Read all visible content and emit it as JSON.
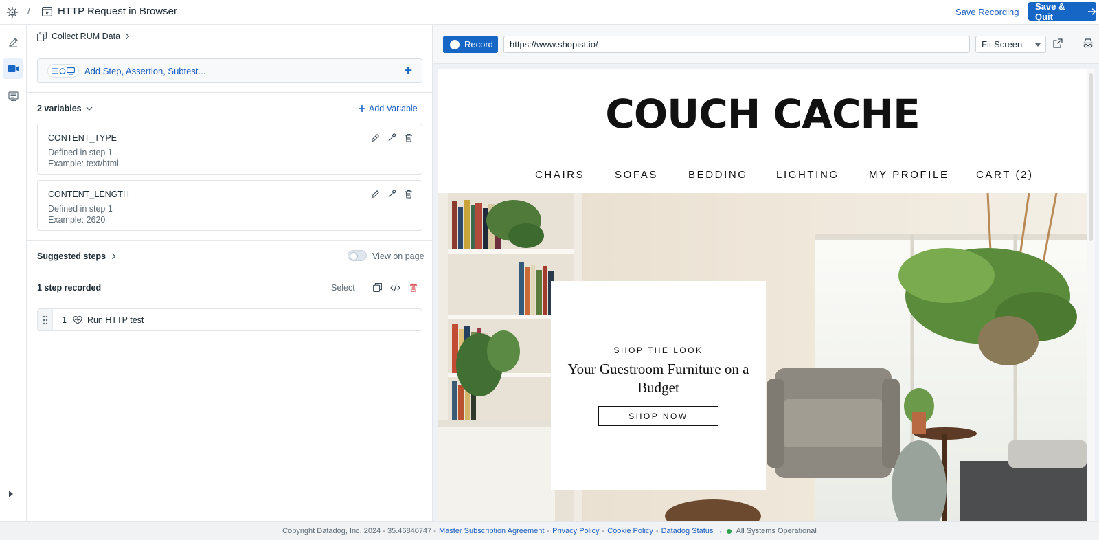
{
  "header": {
    "separator": "/",
    "title": "HTTP Request in Browser",
    "save_recording": "Save Recording",
    "save_quit": "Save & Quit",
    "accent_color": "#1666c5"
  },
  "rail": {
    "items": [
      {
        "icon": "pencil-icon"
      },
      {
        "icon": "video-camera-icon",
        "active": true
      },
      {
        "icon": "list-icon"
      }
    ]
  },
  "panel": {
    "breadcrumb": "Collect RUM Data",
    "add_step_label": "Add Step, Assertion, Subtest...",
    "add_step_plus": "+",
    "variables_heading": "2 variables",
    "add_variable": "Add Variable",
    "variables": [
      {
        "name": "CONTENT_TYPE",
        "defined": "Defined in step 1",
        "example": "Example: text/html"
      },
      {
        "name": "CONTENT_LENGTH",
        "defined": "Defined in step 1",
        "example": "Example: 2620"
      }
    ],
    "suggested_steps": "Suggested steps",
    "view_on_page": "View on page",
    "steps_recorded": "1 step recorded",
    "select_label": "Select",
    "steps": [
      {
        "number": "1",
        "label": "Run HTTP test"
      }
    ]
  },
  "browser": {
    "record_label": "Record",
    "url": "https://www.shopist.io/",
    "fit_select": "Fit Screen"
  },
  "site": {
    "logo": "COUCH CACHE",
    "nav": [
      "CHAIRS",
      "SOFAS",
      "BEDDING",
      "LIGHTING",
      "MY PROFILE",
      "CART (2)"
    ],
    "promo_kicker": "SHOP THE LOOK",
    "promo_title": "Your Guestroom Furniture on a Budget",
    "promo_button": "SHOP NOW"
  },
  "footer": {
    "copyright": "Copyright Datadog, Inc. 2024 - 35.46840747 -",
    "msa": "Master Subscription Agreement",
    "sep1": "-",
    "privacy": "Privacy Policy",
    "sep2": "-",
    "cookie": "Cookie Policy",
    "sep3": "-",
    "status_link": "Datadog Status →",
    "status_text": "All Systems Operational"
  }
}
